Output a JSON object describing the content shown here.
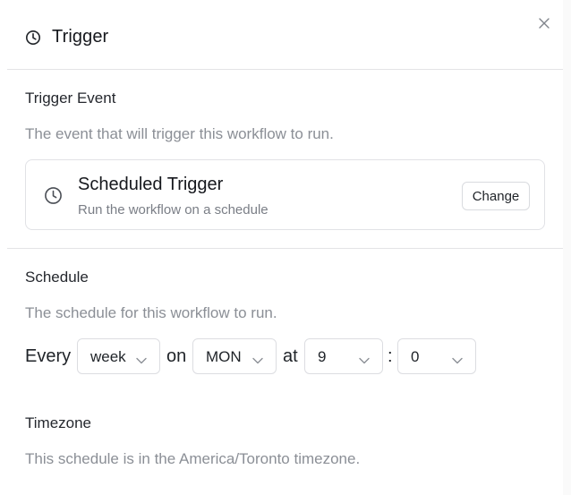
{
  "header": {
    "title": "Trigger",
    "icon": "clock-icon",
    "close_icon": "close-icon"
  },
  "trigger_event": {
    "title": "Trigger Event",
    "description": "The event that will trigger this workflow to run.",
    "card": {
      "icon": "clock-icon",
      "name": "Scheduled Trigger",
      "subtitle": "Run the workflow on a schedule",
      "change_label": "Change"
    }
  },
  "schedule": {
    "title": "Schedule",
    "description": "The schedule for this workflow to run.",
    "every_label": "Every",
    "frequency_value": "week",
    "on_label": "on",
    "day_value": "MON",
    "at_label": "at",
    "hour_value": "9",
    "colon": ":",
    "minute_value": "0"
  },
  "timezone": {
    "title": "Timezone",
    "description": "This schedule is in the America/Toronto timezone."
  },
  "colors": {
    "text": "#1f2328",
    "muted": "#8b8f96",
    "border": "#dcdde1"
  }
}
